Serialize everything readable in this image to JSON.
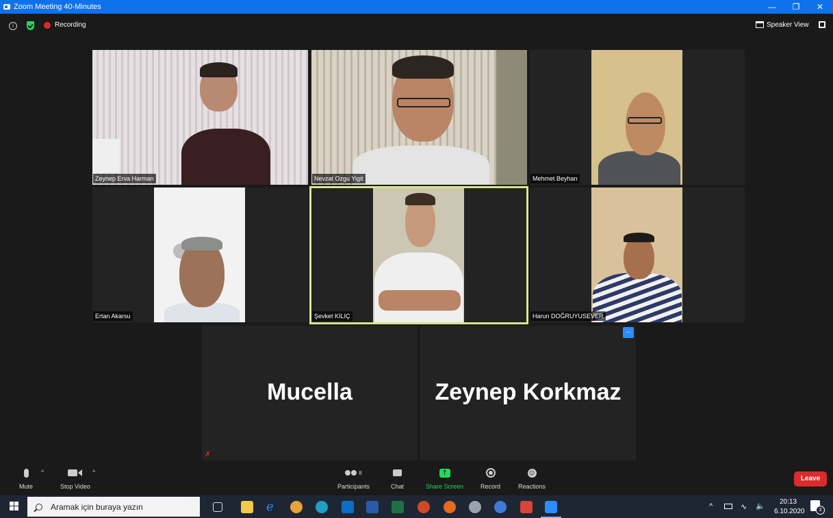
{
  "window": {
    "title": "Zoom Meeting 40-Minutes"
  },
  "topbar": {
    "recording_label": "Recording",
    "view_label": "Speaker View"
  },
  "participants": [
    {
      "name": "Zeynep Erva Harman"
    },
    {
      "name": "Nevzat Ozgu Yigit"
    },
    {
      "name": "Mehmet Beyhan"
    },
    {
      "name": "Ertan Akarsu"
    },
    {
      "name": "Şevket KILIÇ"
    },
    {
      "name": "Harun DOĞRUYUSEVER"
    },
    {
      "name": "Mucella"
    },
    {
      "name": "Zeynep Korkmaz"
    }
  ],
  "more_label": "...",
  "toolbar": {
    "mute": "Mute",
    "stop_video": "Stop Video",
    "participants": "Participants",
    "participants_count": "8",
    "chat": "Chat",
    "share_screen": "Share Screen",
    "record": "Record",
    "reactions": "Reactions",
    "leave": "Leave"
  },
  "taskbar": {
    "search_placeholder": "Aramak için buraya yazın",
    "time": "20:13",
    "date": "6.10.2020",
    "notification_count": "3"
  },
  "colors": {
    "titlebar": "#0e72ed",
    "active_speaker_border": "#d4e88a",
    "share_green": "#23d959",
    "leave_red": "#d92c2c"
  }
}
